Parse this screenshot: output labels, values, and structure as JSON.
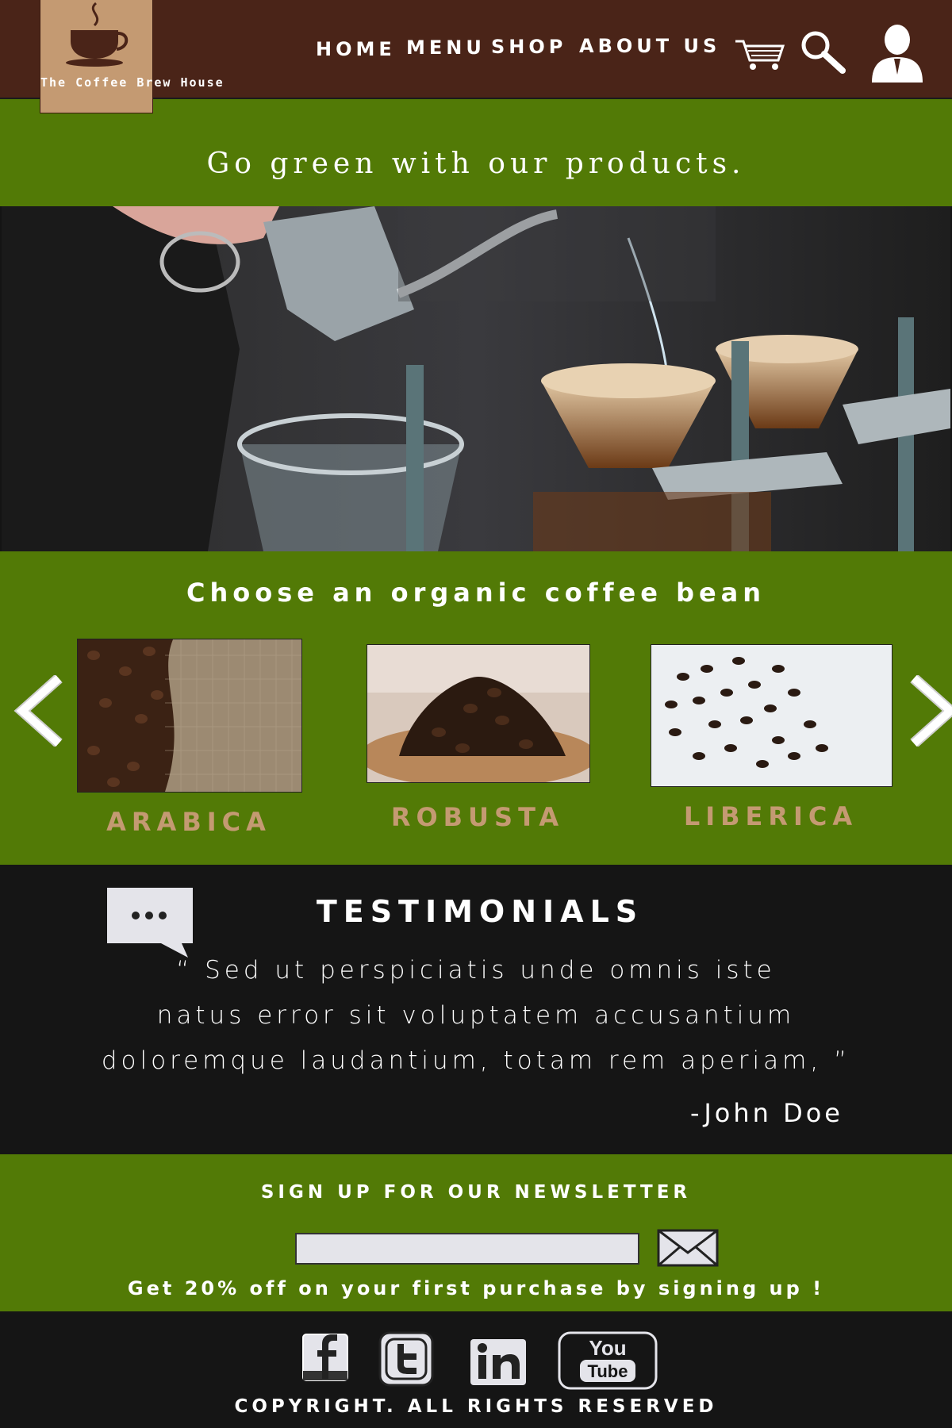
{
  "brand": {
    "name": "The Coffee Brew House",
    "logo_icon": "coffee-cup-icon"
  },
  "colors": {
    "header": "#4a2418",
    "green": "#527a06",
    "dark": "#151515",
    "accent": "#c49a72"
  },
  "nav": {
    "items": [
      "HOME",
      "MENU",
      "SHOP",
      "ABOUT US"
    ]
  },
  "header_icons": [
    "cart-icon",
    "search-icon",
    "user-icon"
  ],
  "tagline": "Go green with our products.",
  "beans": {
    "title": "Choose an organic coffee bean",
    "items": [
      "ARABICA",
      "ROBUSTA",
      "LIBERICA"
    ]
  },
  "testimonials": {
    "title": "TESTIMONIALS",
    "quote_lines": [
      "“ Sed ut perspiciatis unde omnis iste",
      "natus error sit voluptatem accusantium",
      "doloremque laudantium, totam rem aperiam, ”"
    ],
    "author": "-John Doe"
  },
  "newsletter": {
    "title": "SIGN UP FOR OUR NEWSLETTER",
    "email_value": "",
    "subtext": "Get 20% off on your first purchase by signing up !"
  },
  "footer": {
    "social": [
      "facebook-icon",
      "twitter-icon",
      "linkedin-icon",
      "youtube-icon"
    ],
    "copyright": "COPYRIGHT. ALL RIGHTS RESERVED"
  }
}
